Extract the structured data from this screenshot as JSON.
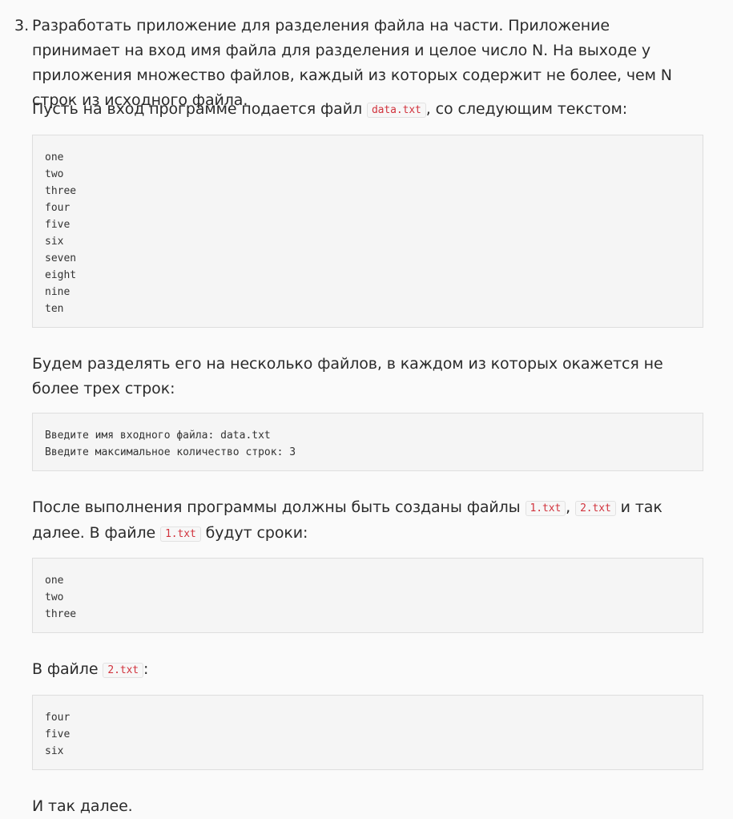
{
  "item": {
    "number": "3.",
    "intro": "Разработать приложение для разделения файла на части. Приложение принимает на вход имя файла для разделения и целое число N. На выходе у приложения множество файлов, каждый из которых содержит не более, чем N строк из исходного файла."
  },
  "p1": {
    "before": "Пусть на вход программе подается файл ",
    "code": "data.txt",
    "after": ", со следующим текстом:"
  },
  "block1": {
    "lines": [
      "one",
      "two",
      "three",
      "four",
      "five",
      "six",
      "seven",
      "eight",
      "nine",
      "ten"
    ]
  },
  "p2": {
    "text": "Будем разделять его на несколько файлов, в каждом из которых окажется не более трех строк:"
  },
  "block2": {
    "lines": [
      "Введите имя входного файла: data.txt",
      "Введите максимальное количество строк: 3"
    ]
  },
  "p3": {
    "part1": "После выполнения программы должны быть созданы файлы ",
    "code1": "1.txt",
    "sep": ", ",
    "code2": "2.txt",
    "part2": " и так далее. В файле ",
    "code3": "1.txt",
    "part3": " будут сроки:"
  },
  "block3": {
    "lines": [
      "one",
      "two",
      "three"
    ]
  },
  "p4": {
    "before": "В файле ",
    "code": "2.txt",
    "after": ":"
  },
  "block4": {
    "lines": [
      "four",
      "five",
      "six"
    ]
  },
  "p5": {
    "text": "И так далее."
  }
}
